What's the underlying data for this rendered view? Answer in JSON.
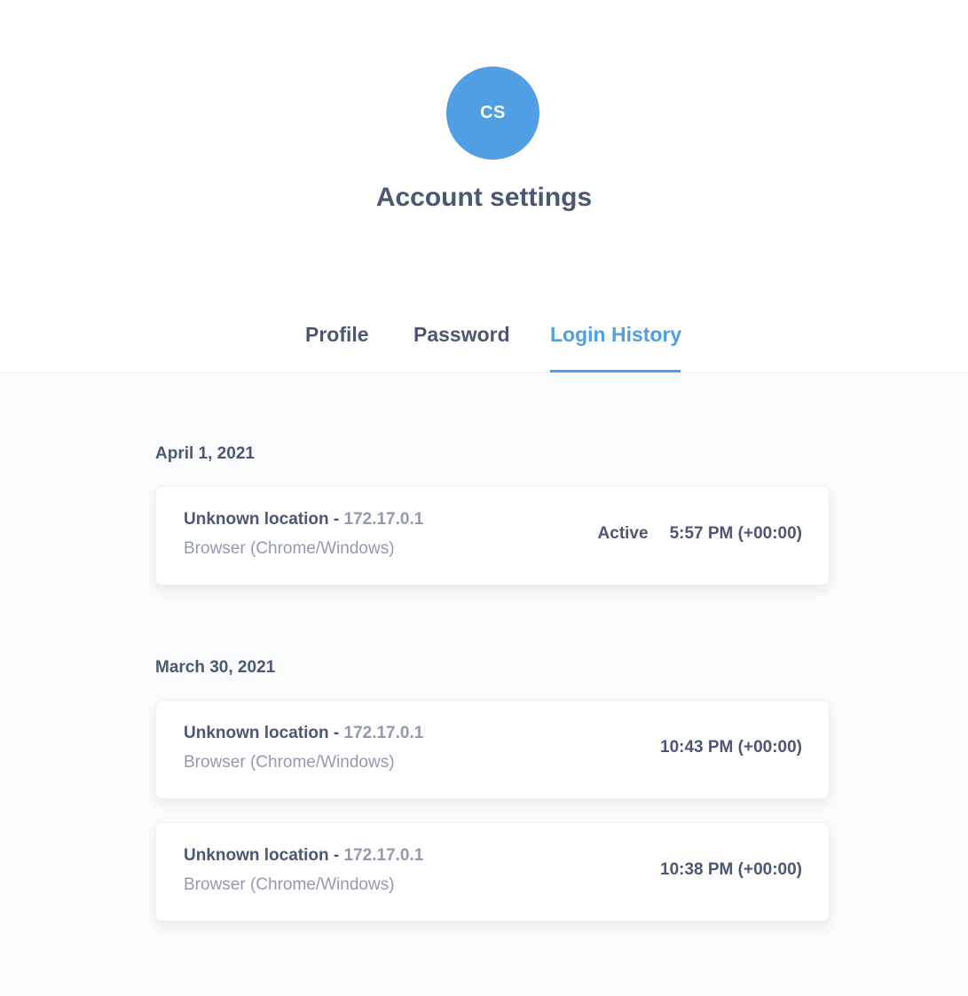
{
  "avatar": {
    "initials": "CS"
  },
  "page_title": "Account settings",
  "tabs": [
    {
      "label": "Profile",
      "active": false
    },
    {
      "label": "Password",
      "active": false
    },
    {
      "label": "Login History",
      "active": true
    }
  ],
  "colors": {
    "accent": "#509ee3",
    "text": "#4c5773",
    "muted": "#949aab",
    "background": "#f9fbfc"
  },
  "history": [
    {
      "date": "April 1, 2021",
      "entries": [
        {
          "location": "Unknown location",
          "separator": " - ",
          "ip": "172.17.0.1",
          "device": "Browser (Chrome/Windows)",
          "status": "Active",
          "time": "5:57 PM (+00:00)"
        }
      ]
    },
    {
      "date": "March 30, 2021",
      "entries": [
        {
          "location": "Unknown location",
          "separator": " - ",
          "ip": "172.17.0.1",
          "device": "Browser (Chrome/Windows)",
          "status": "",
          "time": "10:43 PM (+00:00)"
        },
        {
          "location": "Unknown location",
          "separator": " - ",
          "ip": "172.17.0.1",
          "device": "Browser (Chrome/Windows)",
          "status": "",
          "time": "10:38 PM (+00:00)"
        }
      ]
    }
  ]
}
